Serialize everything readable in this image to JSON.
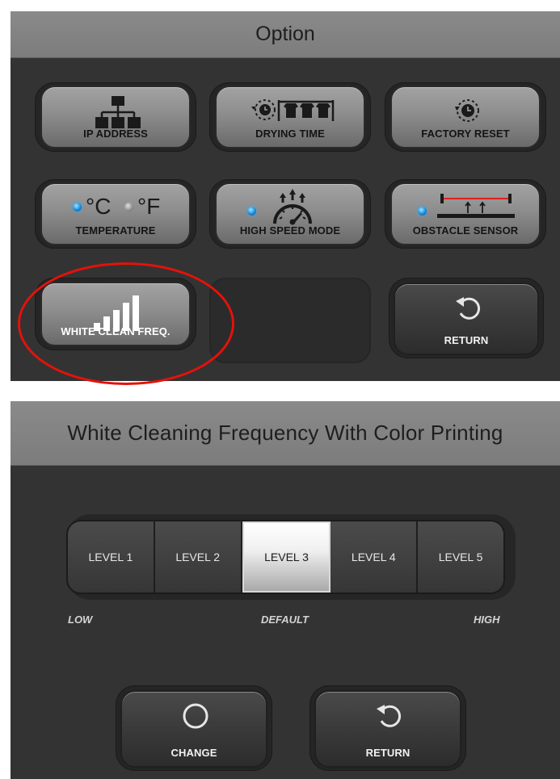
{
  "option_screen": {
    "title": "Option",
    "buttons": [
      {
        "label": "IP ADDRESS",
        "icon": "network-icon"
      },
      {
        "label": "DRYING TIME",
        "icon": "drying-time-icon"
      },
      {
        "label": "FACTORY RESET",
        "icon": "factory-reset-icon"
      },
      {
        "label": "TEMPERATURE",
        "icon": "temperature-icon",
        "unit_c": "°C",
        "unit_f": "°F",
        "selected_unit": "°C"
      },
      {
        "label": "HIGH SPEED MODE",
        "icon": "speedometer-icon",
        "indicator": "on"
      },
      {
        "label": "OBSTACLE SENSOR",
        "icon": "obstacle-sensor-icon",
        "indicator": "on"
      },
      {
        "label": "WHITE CLEAN FREQ.",
        "icon": "signal-bars-icon",
        "highlighted": true
      },
      {
        "label": "RETURN",
        "icon": "return-icon"
      }
    ]
  },
  "frequency_screen": {
    "title": "White Cleaning Frequency With Color Printing",
    "levels": [
      "LEVEL 1",
      "LEVEL 2",
      "LEVEL 3",
      "LEVEL 4",
      "LEVEL 5"
    ],
    "selected_level": "LEVEL 3",
    "scale": {
      "low": "LOW",
      "default": "DEFAULT",
      "high": "HIGH"
    },
    "change_label": "CHANGE",
    "return_label": "RETURN"
  },
  "colors": {
    "panel_bg": "#333333",
    "title_bar": "#858585",
    "indicator_on": "#1a8ad8",
    "highlight": "#e3120b"
  }
}
